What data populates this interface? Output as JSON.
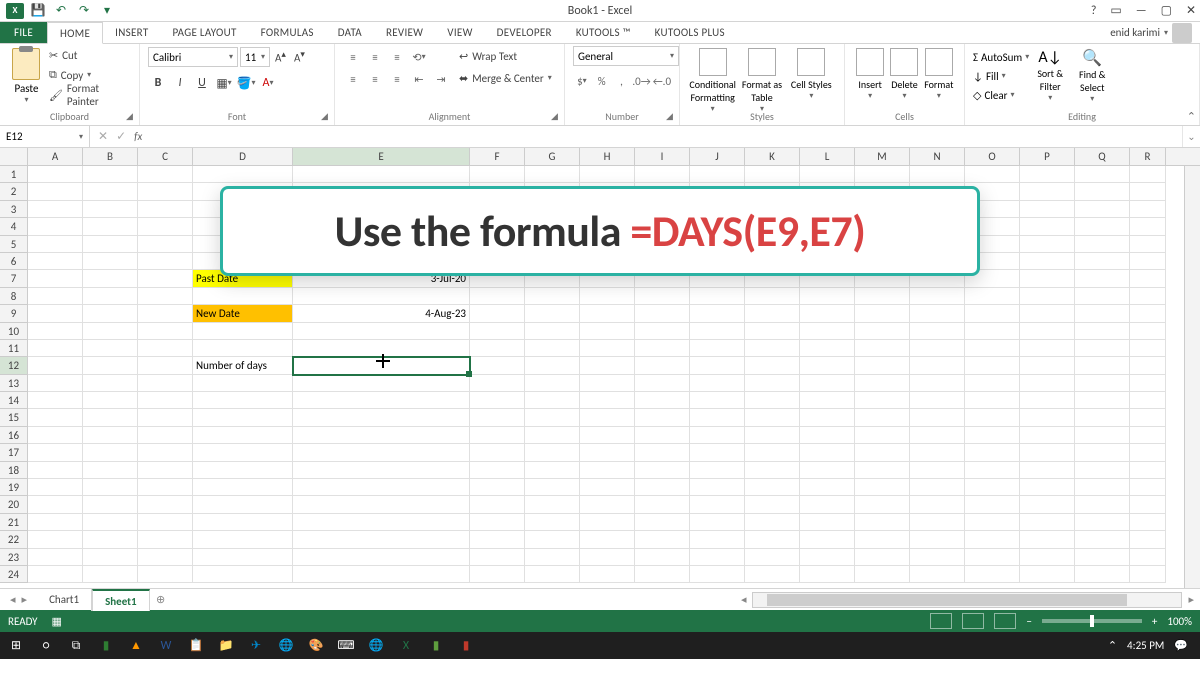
{
  "app": {
    "title": "Book1 - Excel",
    "user": "enid karimi"
  },
  "qat": {
    "save": "💾",
    "undo": "↶",
    "redo": "↷"
  },
  "tabs": {
    "file": "FILE",
    "home": "HOME",
    "insert": "INSERT",
    "page_layout": "PAGE LAYOUT",
    "formulas": "FORMULAS",
    "data": "DATA",
    "review": "REVIEW",
    "view": "VIEW",
    "developer": "DEVELOPER",
    "kutools": "KUTOOLS ™",
    "kutools_plus": "KUTOOLS PLUS"
  },
  "ribbon": {
    "clipboard": {
      "label": "Clipboard",
      "paste": "Paste",
      "cut": "Cut",
      "copy": "Copy",
      "format_painter": "Format Painter"
    },
    "font": {
      "label": "Font",
      "name": "Calibri",
      "size": "11",
      "bold": "B",
      "italic": "I",
      "underline": "U"
    },
    "alignment": {
      "label": "Alignment",
      "wrap": "Wrap Text",
      "merge": "Merge & Center"
    },
    "number": {
      "label": "Number",
      "format": "General"
    },
    "styles": {
      "label": "Styles",
      "conditional": "Conditional Formatting",
      "format_as": "Format as Table",
      "cell_styles": "Cell Styles"
    },
    "cells": {
      "label": "Cells",
      "insert": "Insert",
      "delete": "Delete",
      "format": "Format"
    },
    "editing": {
      "label": "Editing",
      "autosum": "AutoSum",
      "fill": "Fill",
      "clear": "Clear",
      "sort": "Sort & Filter",
      "find": "Find & Select"
    }
  },
  "formula_bar": {
    "name_box": "E12",
    "formula": ""
  },
  "columns": [
    "A",
    "B",
    "C",
    "D",
    "E",
    "F",
    "G",
    "H",
    "I",
    "J",
    "K",
    "L",
    "M",
    "N",
    "O",
    "P",
    "Q",
    "R"
  ],
  "cells": {
    "D7": "Past Date",
    "E7": "3-Jul-20",
    "D9": "New Date",
    "E9": "4-Aug-23",
    "D12": "Number of days"
  },
  "callout": {
    "prefix": "Use the formula ",
    "highlight": "=DAYS(E9,E7)"
  },
  "sheets": {
    "chart1": "Chart1",
    "sheet1": "Sheet1"
  },
  "status": {
    "ready": "READY",
    "zoom": "100%"
  },
  "taskbar": {
    "time": "4:25 PM"
  }
}
